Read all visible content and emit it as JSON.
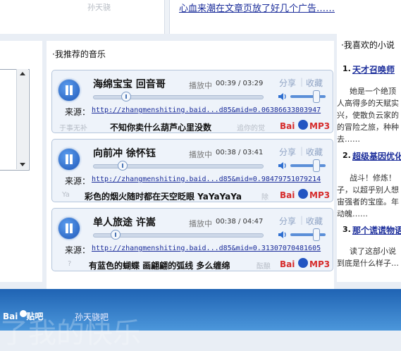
{
  "top": {
    "faded_text": "孙天骁",
    "link_text": "心血来潮在文章页放了好几个广告……"
  },
  "music": {
    "section_title": "·我推荐的音乐",
    "source_label": "来源：",
    "share_label": "分享",
    "fav_label": "收藏",
    "baidu_label": "Bai",
    "baidu_mp3": "MP3",
    "tracks": [
      {
        "title": "海绵宝宝  回音哥",
        "status": "播放中",
        "time": "00:39 / 03:29",
        "progress": 0.19,
        "volume": 0.7,
        "source_url": "http://zhangmenshiting.baid...d85&mid=0.06386633803947",
        "lyric_prev": "于事无补",
        "lyric_current": "不知你卖什么葫芦心里没数",
        "lyric_next": "追你的觉"
      },
      {
        "title": "向前冲  徐怀钰",
        "status": "播放中",
        "time": "00:38 / 03:41",
        "progress": 0.17,
        "volume": 0.7,
        "source_url": "http://zhangmenshiting.baid...d85&mid=0.98479751079214",
        "lyric_prev": "Ya",
        "lyric_current": "彩色的烟火随时都在天空眨眼 YaYaYaYa",
        "lyric_next": "除"
      },
      {
        "title": "单人旅途  许嵩",
        "status": "播放中",
        "time": "00:38 / 04:47",
        "progress": 0.13,
        "volume": 0.7,
        "source_url": "http://zhangmenshiting.baid...d85&mid=0.31307070481605",
        "lyric_prev": "?",
        "lyric_current": "有蓝色的蝴蝶 画翩翩的弧线 多么缠绵",
        "lyric_next": "酝酿"
      }
    ]
  },
  "novels": {
    "section_title": "·我喜欢的小说",
    "items": [
      {
        "num": "1.",
        "title": "天才召唤师",
        "lines": [
          "她是一个绝顶",
          "人高得多的天赋实",
          "兴，使散负云家的",
          "的冒险之旅，种种",
          "去……"
        ]
      },
      {
        "num": "2.",
        "title": "超级基因优化",
        "lines": [
          "战斗！修炼！",
          "子，以超乎别人想",
          "宙强者的宝座。年",
          "动魄……"
        ]
      },
      {
        "num": "3.",
        "title": "那个谎谎物语",
        "lines": [
          "读了这部小说",
          "到底是什么样子…"
        ]
      }
    ]
  },
  "banner": {
    "logo": "Bai",
    "logo_suffix": "贴吧",
    "forum_name": "孙天骁吧",
    "deco_text": "了我的快乐"
  }
}
